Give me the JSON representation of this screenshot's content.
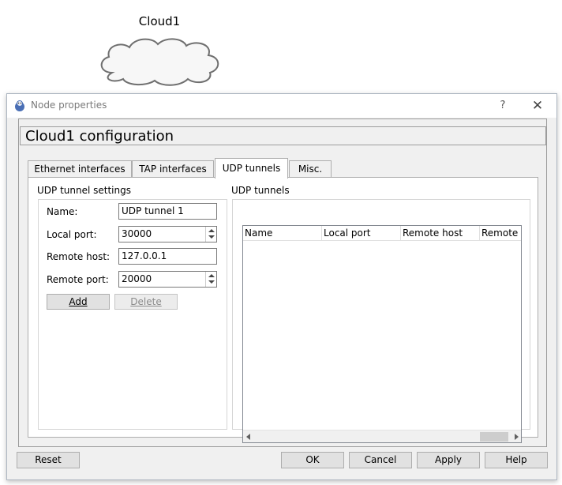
{
  "canvas": {
    "node_label": "Cloud1"
  },
  "dialog": {
    "title": "Node properties",
    "help_label": "?",
    "close_label": "✕",
    "config_title": "Cloud1  configuration",
    "tabs": [
      {
        "label": "Ethernet interfaces",
        "active": false
      },
      {
        "label": "TAP interfaces",
        "active": false
      },
      {
        "label": "UDP tunnels",
        "active": true
      },
      {
        "label": "Misc.",
        "active": false
      }
    ],
    "settings": {
      "group_title": "UDP tunnel settings",
      "name_label": "Name:",
      "name_value": "UDP tunnel 1",
      "local_port_label": "Local port:",
      "local_port_value": "30000",
      "remote_host_label": "Remote host:",
      "remote_host_value": "127.0.0.1",
      "remote_port_label": "Remote port:",
      "remote_port_value": "20000",
      "add_label": "Add",
      "delete_label": "Delete"
    },
    "tunnels": {
      "group_title": "UDP tunnels",
      "columns": [
        "Name",
        "Local port",
        "Remote host",
        "Remote p"
      ],
      "rows": []
    },
    "buttons": {
      "reset": "Reset",
      "ok": "OK",
      "cancel": "Cancel",
      "apply": "Apply",
      "help": "Help"
    }
  }
}
